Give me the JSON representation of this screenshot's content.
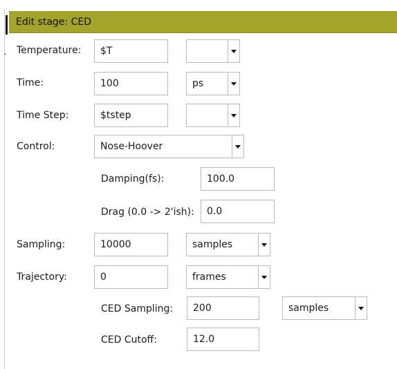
{
  "header": {
    "title": "Edit stage: CED"
  },
  "side_tick": "'",
  "temperature": {
    "label": "Temperature:",
    "value": "$T",
    "unit": ""
  },
  "time": {
    "label": "Time:",
    "value": "100",
    "unit": "ps"
  },
  "time_step": {
    "label": "Time Step:",
    "value": "$tstep",
    "unit": ""
  },
  "control": {
    "label": "Control:",
    "value": "Nose-Hoover"
  },
  "damping": {
    "label": "Damping(fs):",
    "value": "100.0"
  },
  "drag": {
    "label": "Drag (0.0 -> 2'ish):",
    "value": "0.0"
  },
  "sampling": {
    "label": "Sampling:",
    "value": "10000",
    "unit": "samples"
  },
  "trajectory": {
    "label": "Trajectory:",
    "value": "0",
    "unit": "frames"
  },
  "ced_sampling": {
    "label": "CED Sampling:",
    "value": "200",
    "unit": "samples"
  },
  "ced_cutoff": {
    "label": "CED Cutoff:",
    "value": "12.0"
  },
  "icons": {
    "dropdown": "chevron-down-icon"
  },
  "colors": {
    "header_bg": "#a4a32c",
    "field_border": "#b9b9b9"
  }
}
